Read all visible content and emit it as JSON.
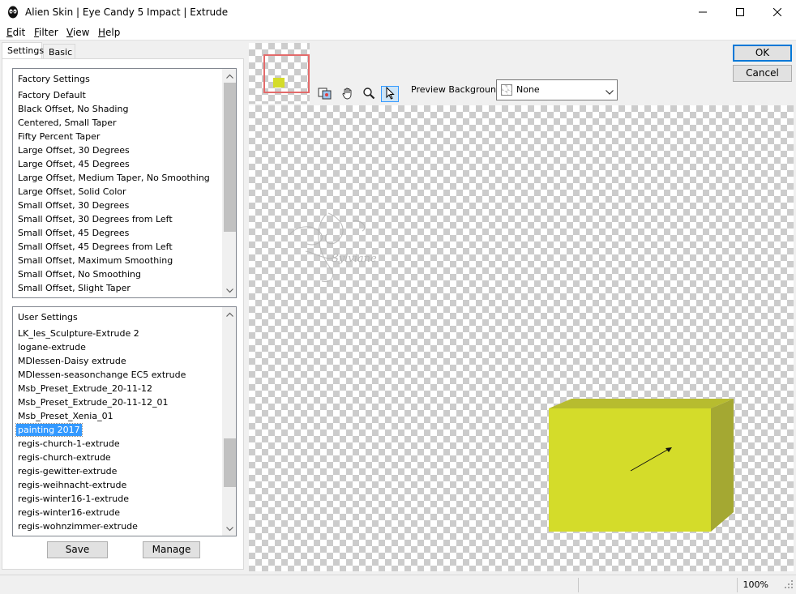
{
  "window": {
    "title": "Alien Skin | Eye Candy 5 Impact | Extrude",
    "icon": "alien-skin-logo-icon",
    "controls": [
      "minimize-icon",
      "maximize-icon",
      "close-icon"
    ]
  },
  "menu": {
    "items": [
      {
        "label": "Edit",
        "accel": "E",
        "rest": "dit"
      },
      {
        "label": "Filter",
        "accel": "F",
        "rest": "ilter"
      },
      {
        "label": "View",
        "accel": "V",
        "rest": "iew"
      },
      {
        "label": "Help",
        "accel": "H",
        "rest": "elp"
      }
    ]
  },
  "tabs": [
    {
      "label": "Settings",
      "active": true
    },
    {
      "label": "Basic",
      "active": false
    }
  ],
  "factory_settings": {
    "header": "Factory Settings",
    "items": [
      "Factory Default",
      "Black Offset, No Shading",
      "Centered, Small Taper",
      "Fifty Percent Taper",
      "Large Offset, 30 Degrees",
      "Large Offset, 45 Degrees",
      "Large Offset, Medium Taper, No Smoothing",
      "Large Offset, Solid Color",
      "Small Offset, 30 Degrees",
      "Small Offset, 30 Degrees from Left",
      "Small Offset, 45 Degrees",
      "Small Offset, 45 Degrees from Left",
      "Small Offset, Maximum Smoothing",
      "Small Offset, No Smoothing",
      "Small Offset, Slight Taper"
    ]
  },
  "user_settings": {
    "header": "User Settings",
    "selected": "painting 2017",
    "items": [
      "LK_les_Sculpture-Extrude 2",
      "logane-extrude",
      "MDlessen-Daisy extrude",
      "MDlessen-seasonchange EC5 extrude",
      "Msb_Preset_Extrude_20-11-12",
      "Msb_Preset_Extrude_20-11-12_01",
      "Msb_Preset_Xenia_01",
      "painting 2017",
      "regis-church-1-extrude",
      "regis-church-extrude",
      "regis-gewitter-extrude",
      "regis-weihnacht-extrude",
      "regis-winter16-1-extrude",
      "regis-winter16-extrude",
      "regis-wohnzimmer-extrude"
    ]
  },
  "buttons": {
    "save": "Save",
    "manage": "Manage",
    "ok": "OK",
    "cancel": "Cancel"
  },
  "preview": {
    "background_label": "Preview Background:",
    "background_value": "None",
    "tools": [
      "preview-toggle-icon",
      "hand-pan-icon",
      "zoom-magnifier-icon",
      "pointer-arrow-icon"
    ],
    "active_tool": "pointer-arrow-icon",
    "object_color_front": "#d4dc2a",
    "object_color_side": "#a4a832",
    "object_color_top": "#b7bc2f",
    "watermark": "Sylviane"
  },
  "status": {
    "zoom": "100%"
  }
}
